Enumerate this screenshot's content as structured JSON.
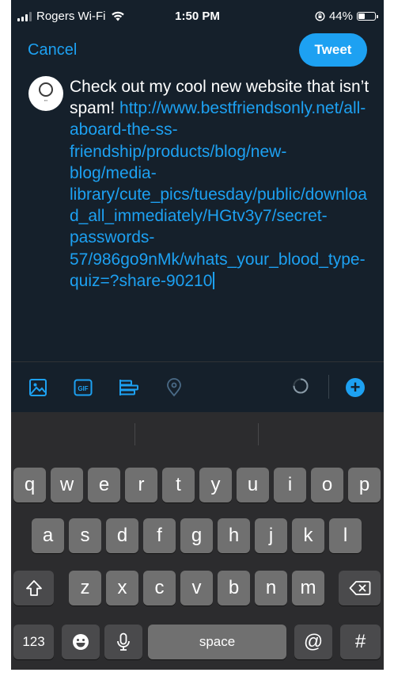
{
  "status_bar": {
    "carrier": "Rogers Wi-Fi",
    "time": "1:50 PM",
    "battery": "44%",
    "battery_level": 0.44
  },
  "compose": {
    "cancel_label": "Cancel",
    "tweet_label": "Tweet",
    "text_plain": "Check out my cool new website that isn’t spam! ",
    "text_link": "http://www.bestfriendsonly.net/all-aboard-the-ss-friendship/products/blog/new-blog/media-library/cute_pics/tuesday/public/download_all_immediately/HGtv3y7/secret-passwords-57/986go9nMk/whats_your_blood_type-quiz=?share-90210"
  },
  "toolbar": {
    "icons": [
      "image-icon",
      "gif-icon",
      "poll-icon",
      "location-icon",
      "character-progress-ring",
      "add-thread-icon"
    ],
    "gif_label": "GIF",
    "plus_label": "+"
  },
  "keyboard": {
    "row1": [
      "q",
      "w",
      "e",
      "r",
      "t",
      "y",
      "u",
      "i",
      "o",
      "p"
    ],
    "row2": [
      "a",
      "s",
      "d",
      "f",
      "g",
      "h",
      "j",
      "k",
      "l"
    ],
    "row3": [
      "z",
      "x",
      "c",
      "v",
      "b",
      "n",
      "m"
    ],
    "numbers_label": "123",
    "space_label": "space",
    "at_label": "@",
    "hash_label": "#"
  },
  "colors": {
    "background": "#15202b",
    "accent": "#1da1f2",
    "keyboard": "#2c2c2e",
    "key": "#707070",
    "key_dark": "#4a4a4c"
  }
}
